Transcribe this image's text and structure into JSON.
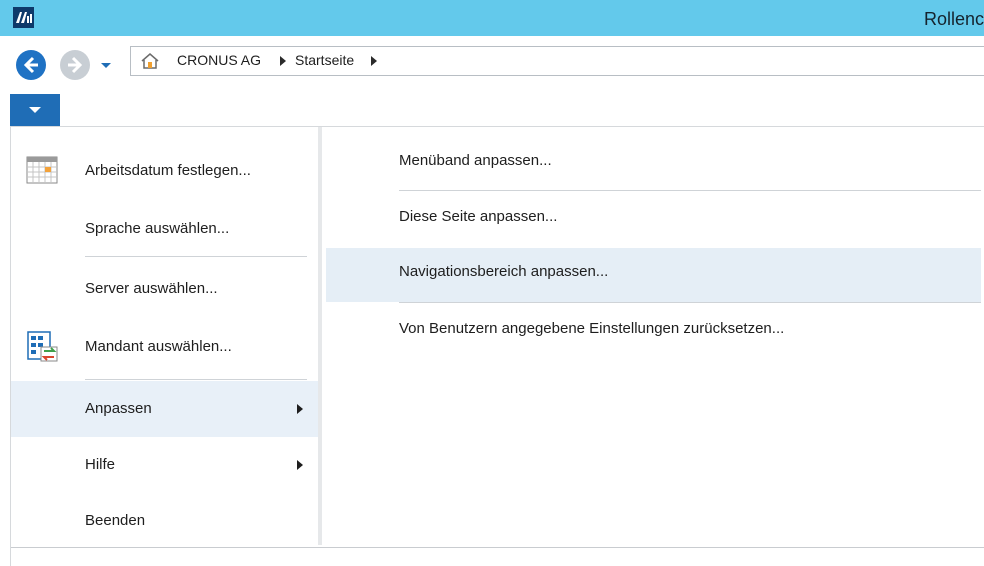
{
  "window": {
    "title": "Rollenc"
  },
  "address_bar": {
    "breadcrumbs": [
      "CRONUS AG",
      "Startseite"
    ]
  },
  "app_menu": {
    "left_items": [
      {
        "label": "Arbeitsdatum festlegen...",
        "icon": "calendar-icon"
      },
      {
        "label": "Sprache auswählen..."
      },
      {
        "label": "Server auswählen..."
      },
      {
        "label": "Mandant auswählen...",
        "icon": "company-switch-icon"
      },
      {
        "label": "Anpassen",
        "submenu": true,
        "active": true
      },
      {
        "label": "Hilfe",
        "submenu": true
      },
      {
        "label": "Beenden"
      }
    ],
    "right_items": [
      {
        "label": "Menüband anpassen..."
      },
      {
        "label": "Diese Seite anpassen..."
      },
      {
        "label": "Navigationsbereich anpassen...",
        "highlighted": true
      },
      {
        "label": "Von Benutzern angegebene Einstellungen zurücksetzen..."
      }
    ]
  },
  "colors": {
    "titlebar": "#63c9eb",
    "accent": "#1f6db6",
    "active_item": "#e8f0f8",
    "hover_item": "#e5eef6"
  }
}
